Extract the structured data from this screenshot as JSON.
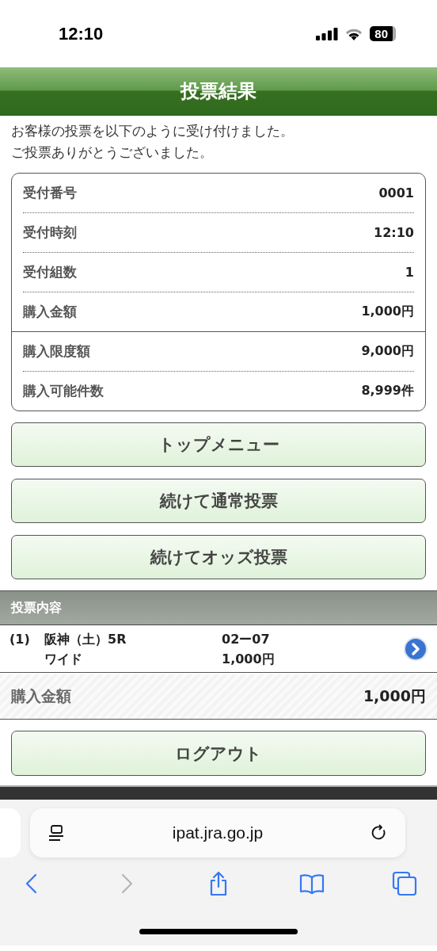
{
  "status_bar": {
    "time": "12:10",
    "battery": "80"
  },
  "header": {
    "title": "投票結果"
  },
  "message": [
    "お客様の投票を以下のように受け付けました。",
    "ご投票ありがとうございました。"
  ],
  "summary": {
    "groups": [
      [
        {
          "label": "受付番号",
          "value": "0001"
        },
        {
          "label": "受付時刻",
          "value": "12:10"
        },
        {
          "label": "受付組数",
          "value": "1"
        },
        {
          "label": "購入金額",
          "value": "1,000円"
        }
      ],
      [
        {
          "label": "購入限度額",
          "value": "9,000円"
        },
        {
          "label": "購入可能件数",
          "value": "8,999件"
        }
      ]
    ]
  },
  "buttons": [
    "トップメニュー",
    "続けて通常投票",
    "続けてオッズ投票"
  ],
  "bets": {
    "title": "投票内容",
    "items": [
      {
        "number": "(1)",
        "race": "阪神（土）5R",
        "type": "ワイド",
        "combination": "02ー07",
        "amount": "1,000円"
      }
    ]
  },
  "total": {
    "label": "購入金額",
    "value": "1,000円"
  },
  "logout": "ログアウト",
  "browser": {
    "url": "ipat.jra.go.jp",
    "toolbar": [
      {
        "kind": "back",
        "disabled": false
      },
      {
        "kind": "forward",
        "disabled": true
      },
      {
        "kind": "share",
        "disabled": false
      },
      {
        "kind": "bookmarks",
        "disabled": false
      },
      {
        "kind": "tabs",
        "disabled": false
      }
    ]
  }
}
